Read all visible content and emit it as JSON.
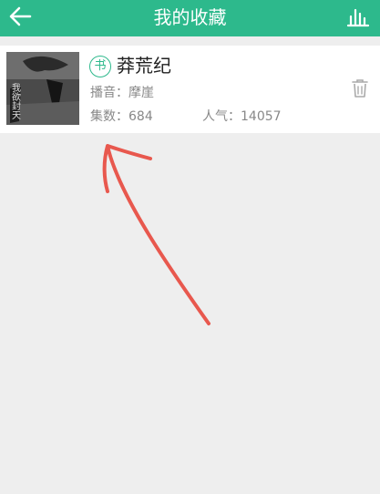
{
  "header": {
    "title": "我的收藏",
    "back_icon": "arrow-left-icon",
    "stats_icon": "bar-chart-icon"
  },
  "favorites": [
    {
      "badge": "书",
      "title": "莽荒纪",
      "narrator": "播音：摩崖",
      "episodes": "集数：684",
      "popularity": "人气：14057",
      "cover_text": "我欲封天",
      "delete_icon": "trash-icon"
    }
  ],
  "colors": {
    "brand": "#2db98c",
    "annotation": "#e8584e",
    "background": "#eeeeee"
  }
}
